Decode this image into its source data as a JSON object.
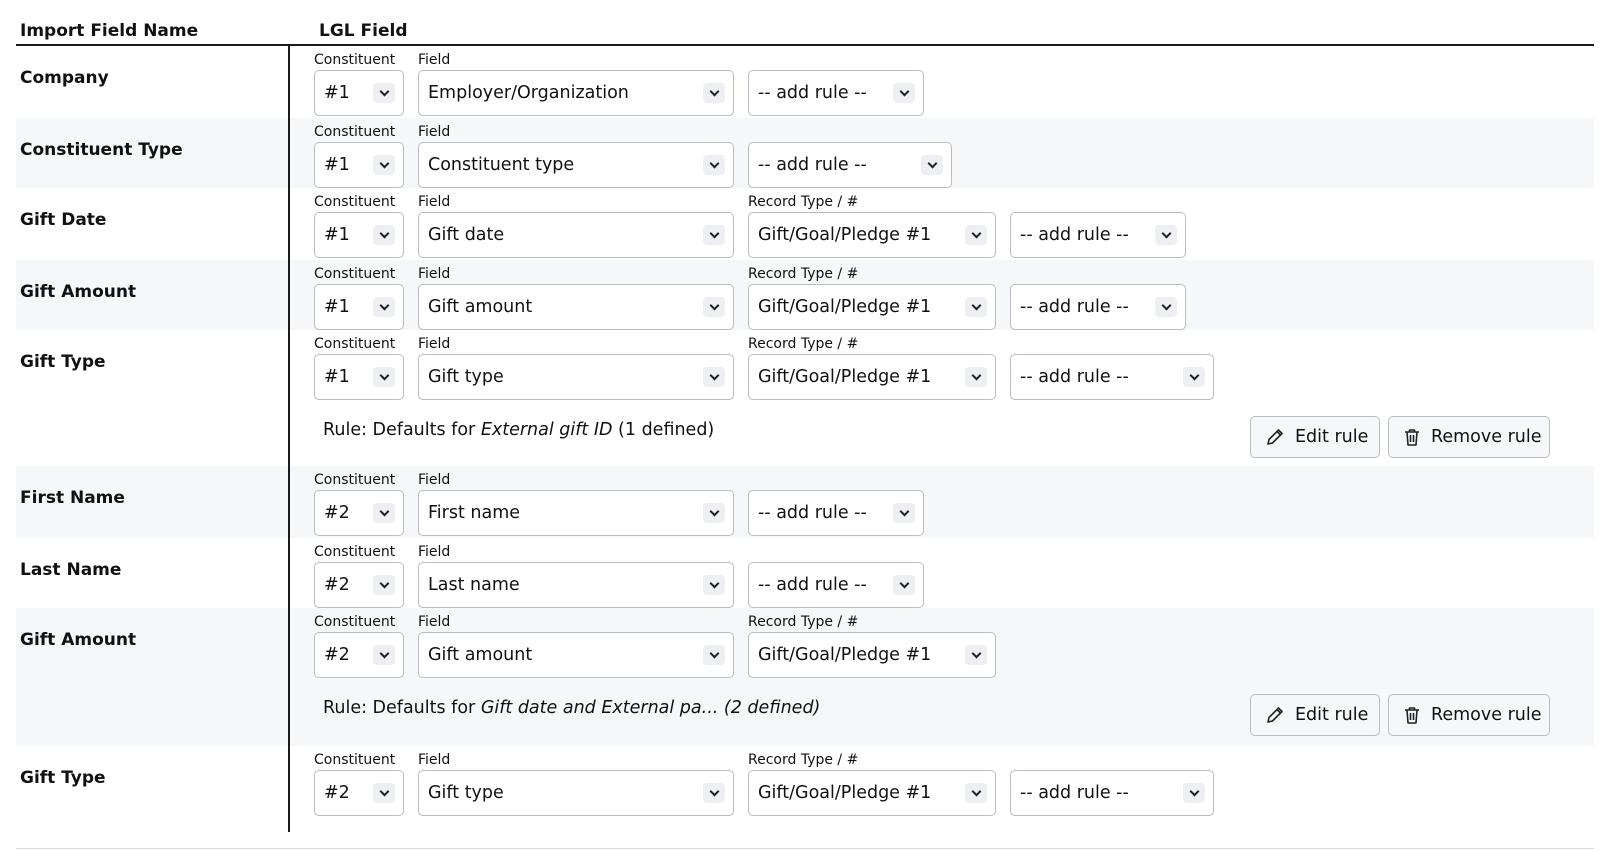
{
  "header": {
    "import_field_name": "Import Field Name",
    "lgl_field": "LGL Field"
  },
  "labels": {
    "constituent": "Constituent",
    "field": "Field",
    "record_type": "Record Type / #"
  },
  "buttons": {
    "edit_rule": "Edit rule",
    "remove_rule": "Remove rule"
  },
  "icons": {
    "edit": "pencil-icon",
    "remove": "trash-icon",
    "dropdown": "chevron-down-icon"
  },
  "rows": [
    {
      "name": "Company",
      "constituent": "#1",
      "field": "Employer/Organization",
      "rule_select": "-- add rule --"
    },
    {
      "name": "Constituent Type",
      "constituent": "#1",
      "field": "Constituent type",
      "rule_select": "-- add rule --"
    },
    {
      "name": "Gift Date",
      "constituent": "#1",
      "field": "Gift date",
      "record_type": "Gift/Goal/Pledge #1",
      "rule_select": "-- add rule --"
    },
    {
      "name": "Gift Amount",
      "constituent": "#1",
      "field": "Gift amount",
      "record_type": "Gift/Goal/Pledge #1",
      "rule_select": "-- add rule --"
    },
    {
      "name": "Gift Type",
      "constituent": "#1",
      "field": "Gift type",
      "record_type": "Gift/Goal/Pledge #1",
      "rule_select": "-- add rule --",
      "rule": {
        "prefix": "Rule: Defaults for ",
        "target": "External gift ID",
        "suffix": " (1 defined)"
      }
    },
    {
      "name": "First Name",
      "constituent": "#2",
      "field": "First name",
      "rule_select": "-- add rule --"
    },
    {
      "name": "Last Name",
      "constituent": "#2",
      "field": "Last name",
      "rule_select": "-- add rule --"
    },
    {
      "name": "Gift Amount",
      "constituent": "#2",
      "field": "Gift amount",
      "record_type": "Gift/Goal/Pledge #1",
      "rule": {
        "prefix": "Rule: Defaults for ",
        "target": "Gift date and External pa... (2 defined)",
        "suffix": ""
      }
    },
    {
      "name": "Gift Type",
      "constituent": "#2",
      "field": "Gift type",
      "record_type": "Gift/Goal/Pledge #1",
      "rule_select": "-- add rule --"
    }
  ]
}
